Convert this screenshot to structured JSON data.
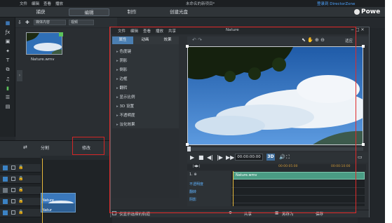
{
  "app": {
    "menu": [
      "文件",
      "编辑",
      "查看",
      "播放"
    ],
    "title": "未命名的新项目*",
    "link": "登录到 DirectorZone",
    "brand": "Powe",
    "tabs": [
      {
        "label": "捕获",
        "active": false
      },
      {
        "label": "编辑",
        "active": true
      },
      {
        "label": "制作",
        "active": false
      },
      {
        "label": "创建光盘",
        "active": false
      }
    ]
  },
  "library": {
    "filter1": "媒体内容",
    "filter2": "视频",
    "items": [
      {
        "name": "Nature.wmv"
      }
    ]
  },
  "funcbar": {
    "split": "分割",
    "modify": "修改"
  },
  "timeline": {
    "clip_label": "Nature",
    "clip_label2": "Natur"
  },
  "editor": {
    "menu": [
      "文件",
      "编辑",
      "查看",
      "播放",
      "共享"
    ],
    "title": "Nature",
    "tabs": [
      {
        "label": "属性",
        "active": true
      },
      {
        "label": "动画",
        "active": false
      },
      {
        "label": "效果",
        "active": false
      }
    ],
    "props": [
      "色度键",
      "阴影",
      "倒影",
      "边框",
      "翻转",
      "显示比例",
      "3D 设置",
      "不透明度",
      "淡化效果"
    ],
    "view_select": "适应",
    "timecode": "00:00:00:00",
    "badge": "3D",
    "ruler": [
      "00:00:05:00",
      "00:00:10:00"
    ],
    "track_clip": "Nature.wmv",
    "track_rows": [
      "不透明度",
      "翻转",
      "阴影"
    ],
    "track_head": "1. ⊕",
    "checkbox_label": "仅显示选择的轨道",
    "buttons": {
      "share": "共享",
      "save_as": "另存为",
      "save": "保存"
    }
  }
}
